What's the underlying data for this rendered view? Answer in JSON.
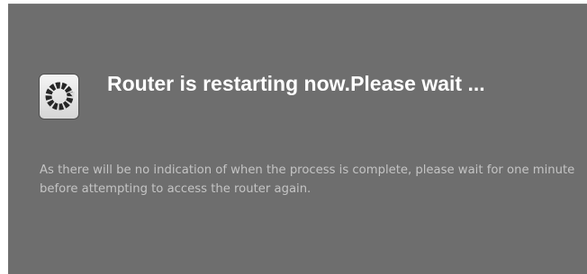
{
  "dialog": {
    "icon": "restart-spinner-icon",
    "title": "Router is restarting now.Please wait ...",
    "message": "As there will be no indication of when the process is complete, please wait for one minute before attempting to access the router again."
  },
  "colors": {
    "dialog_background": "#6e6e6e",
    "title_text": "#ffffff",
    "message_text": "#c4c4c4"
  }
}
